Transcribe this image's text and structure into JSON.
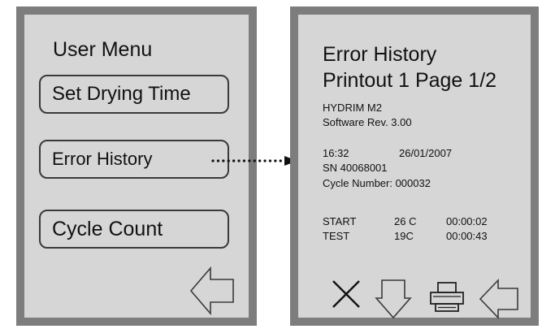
{
  "user_menu": {
    "title": "User Menu",
    "buttons": [
      {
        "label": "Set Drying Time"
      },
      {
        "label": "Error History"
      },
      {
        "label": "Cycle Count"
      }
    ],
    "back_icon": "back-arrow-icon"
  },
  "error_history": {
    "title_line1": "Error History",
    "title_line2": "Printout 1 Page 1/2",
    "model": "HYDRIM M2",
    "software": "Software Rev. 3.00",
    "time": "16:32",
    "date": "26/01/2007",
    "serial": "SN  40068001",
    "cycle_number": "Cycle Number:   000032",
    "log": [
      {
        "event": "START",
        "temp": "26 C",
        "elapsed": "00:00:02"
      },
      {
        "event": "TEST",
        "temp": "19C",
        "elapsed": "00:00:43"
      }
    ],
    "toolbar_icons": [
      "close-icon",
      "down-arrow-icon",
      "printer-icon",
      "back-arrow-icon"
    ]
  },
  "colors": {
    "screen_bg": "#d6d6d6",
    "bezel": "#7d7d7d",
    "text": "#111111"
  }
}
